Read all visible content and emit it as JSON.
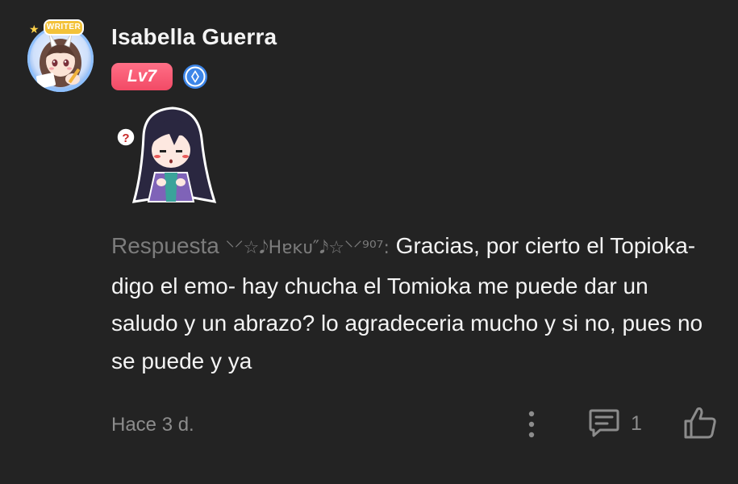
{
  "comment": {
    "author": {
      "name": "Isabella Guerra",
      "level_label": "Lv7",
      "avatar_frame_label": "WRITER",
      "avatar_icon": "anime-avatar",
      "member_badge_icon": "blue-diamond-badge-icon"
    },
    "sticker": {
      "icon": "confused-anime-girl-sticker"
    },
    "reply": {
      "prefix": "Respuesta",
      "target_user": "⸌⸍☆𝅘𝅥𝅮Hɐĸᴜ″𝅘𝅥𝅯☆⸌⸍⁹⁰⁷:",
      "body": "Gracias, por cierto el Topioka- digo el emo- hay chucha el Tomioka me puede dar un saludo y un abrazo? lo agradeceria mucho y si no, pues no se puede y ya"
    },
    "footer": {
      "timestamp": "Hace 3 d.",
      "more_icon": "vertical-ellipsis-icon",
      "reply_icon": "comment-bubble-icon",
      "reply_count": "1",
      "like_icon": "thumbs-up-icon"
    }
  },
  "colors": {
    "background": "#232323",
    "text_primary": "#f4f4f4",
    "text_muted": "#8c8c8c",
    "level_badge": "#f24a66",
    "member_badge": "#3d86e8"
  }
}
